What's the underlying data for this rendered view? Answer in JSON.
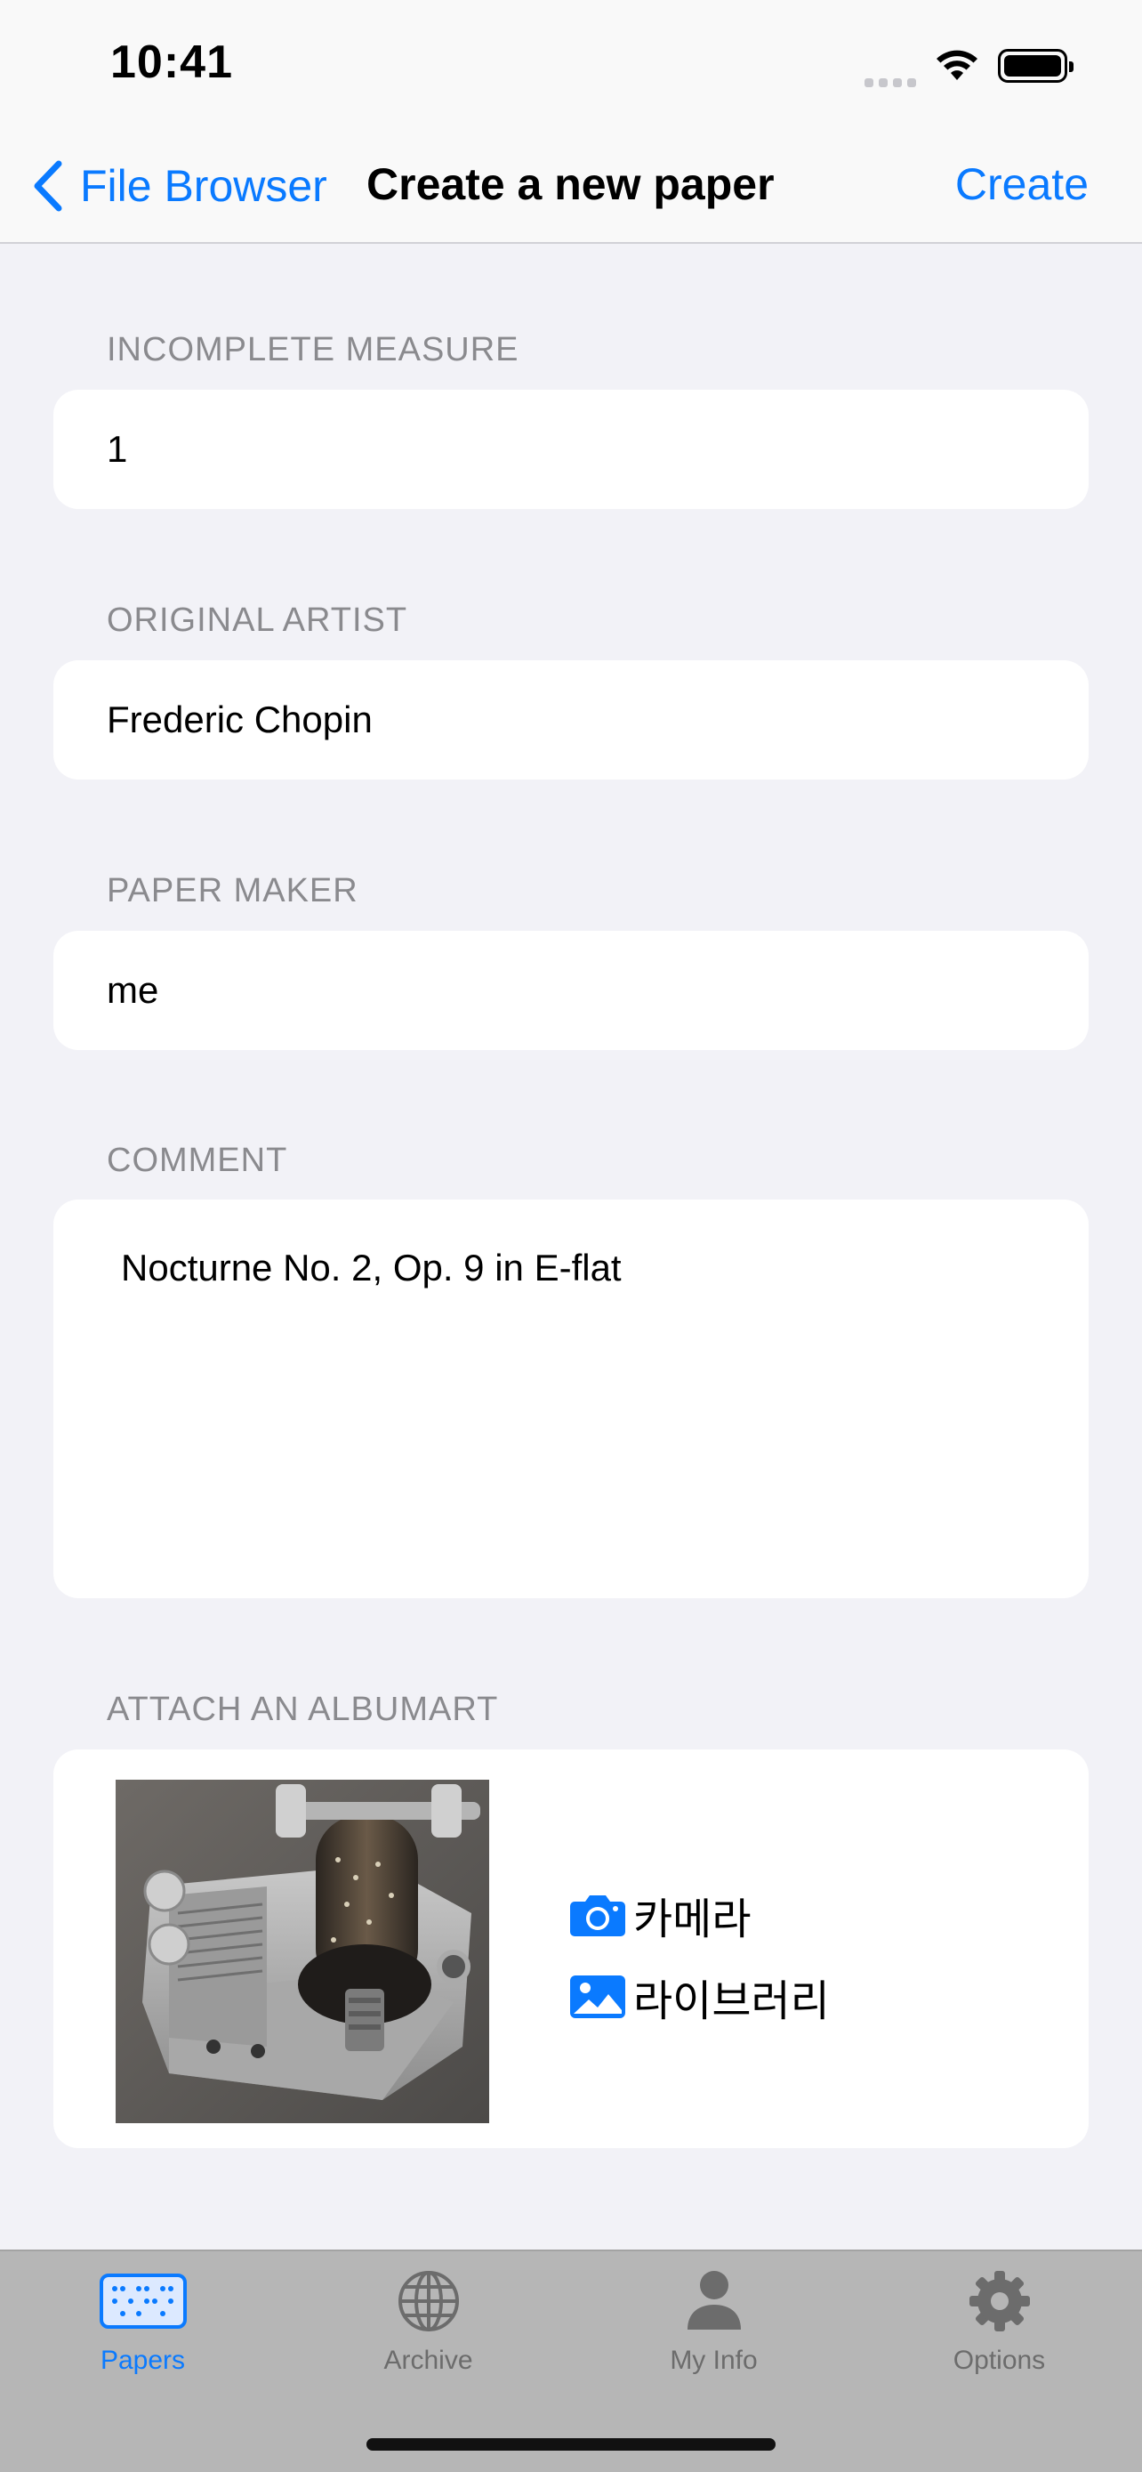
{
  "status_bar": {
    "time": "10:41"
  },
  "nav": {
    "back_label": "File Browser",
    "title": "Create a new paper",
    "action_label": "Create"
  },
  "form": {
    "incomplete_measure": {
      "label": "INCOMPLETE MEASURE",
      "value": "1"
    },
    "original_artist": {
      "label": "ORIGINAL ARTIST",
      "value": "Frederic Chopin"
    },
    "paper_maker": {
      "label": "PAPER MAKER",
      "value": "me"
    },
    "comment": {
      "label": "COMMENT",
      "value": "Nocturne No. 2, Op. 9 in E-flat"
    },
    "albumart": {
      "label": "ATTACH AN ALBUMART",
      "camera_label": "카메라",
      "library_label": "라이브러리"
    }
  },
  "tabs": [
    {
      "label": "Papers",
      "icon": "braille-paper-icon",
      "active": true
    },
    {
      "label": "Archive",
      "icon": "globe-icon",
      "active": false
    },
    {
      "label": "My Info",
      "icon": "person-icon",
      "active": false
    },
    {
      "label": "Options",
      "icon": "gear-icon",
      "active": false
    }
  ],
  "colors": {
    "accent": "#0a7aff",
    "background": "#f2f2f7",
    "card": "#ffffff",
    "section_header": "#8a8a8e",
    "tab_bar": "#b6b6b6"
  }
}
